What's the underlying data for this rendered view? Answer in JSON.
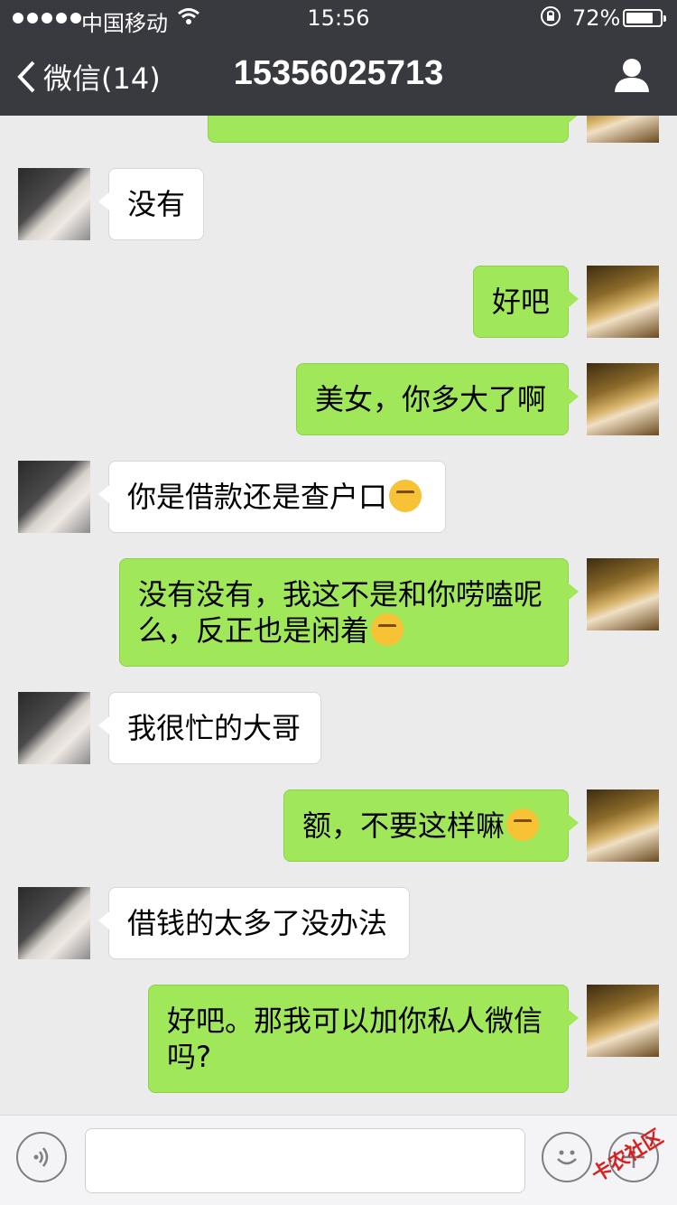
{
  "status": {
    "carrier": "中国移动",
    "time": "15:56",
    "battery_percent": "72%",
    "battery_level": 0.72
  },
  "nav": {
    "back_label": "微信(14)",
    "title": "15356025713",
    "profile_icon": "person-icon"
  },
  "messages": [
    {
      "from": "me",
      "text": ""
    },
    {
      "from": "them",
      "text": "没有"
    },
    {
      "from": "me",
      "text": "好吧"
    },
    {
      "from": "me",
      "text": "美女，你多大了啊"
    },
    {
      "from": "them",
      "text": "你是借款还是查户口",
      "emoji": "laughing-crying-emoji"
    },
    {
      "from": "me",
      "text": "没有没有，我这不是和你唠嗑呢么，反正也是闲着",
      "emoji": "blushing-smile-emoji"
    },
    {
      "from": "them",
      "text": "我很忙的大哥"
    },
    {
      "from": "me",
      "text": "额，不要这样嘛",
      "emoji": "unamused-emoji"
    },
    {
      "from": "them",
      "text": "借钱的太多了没办法"
    },
    {
      "from": "me",
      "text": "好吧。那我可以加你私人微信吗?"
    }
  ],
  "input": {
    "value": "",
    "placeholder": ""
  },
  "watermark": "卡农社区",
  "colors": {
    "nav_bg": "#393a3f",
    "chat_bg": "#ebebeb",
    "mine_bubble": "#a0e75a",
    "their_bubble": "#ffffff"
  }
}
